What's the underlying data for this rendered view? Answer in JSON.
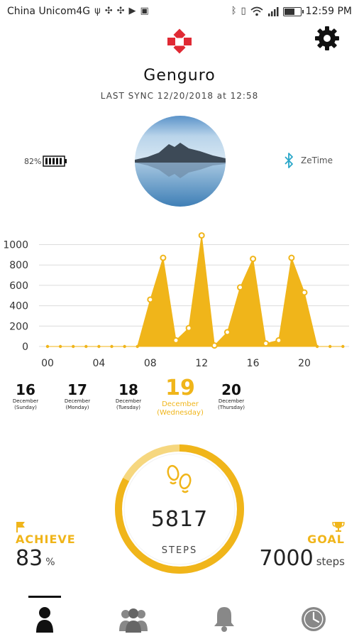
{
  "status_bar": {
    "carrier": "China Unicom4G",
    "time": "12:59 PM",
    "left_icons": [
      "usb-icon",
      "sync-icon",
      "app-icon",
      "play-icon",
      "image-icon"
    ],
    "right_icons": [
      "bluetooth-icon",
      "vibrate-icon",
      "wifi-icon",
      "signal-icon",
      "battery-icon"
    ]
  },
  "header": {
    "app_logo": "brand-logo",
    "settings_icon": "gear-icon"
  },
  "profile": {
    "username": "Genguro",
    "last_sync": "LAST SYNC 12/20/2018 at 12:58"
  },
  "device": {
    "battery_percent": "82%",
    "battery_level": 0.82,
    "device_name": "ZeTime",
    "bluetooth_icon": "bluetooth-icon"
  },
  "colors": {
    "accent": "#f0b51a",
    "accent_light": "#f6d77f",
    "bluetooth": "#2aa7c9",
    "logo_red": "#e02a34"
  },
  "chart_data": {
    "type": "area",
    "x": [
      0,
      1,
      2,
      3,
      4,
      5,
      6,
      7,
      8,
      9,
      10,
      11,
      12,
      13,
      14,
      15,
      16,
      17,
      18,
      19,
      20,
      21,
      22,
      23
    ],
    "y": [
      0,
      0,
      0,
      0,
      0,
      0,
      0,
      0,
      460,
      870,
      60,
      180,
      1090,
      10,
      140,
      580,
      860,
      30,
      60,
      870,
      530,
      0,
      0,
      0
    ],
    "xticks": [
      "00",
      "04",
      "08",
      "12",
      "16",
      "20"
    ],
    "xtick_positions": [
      0,
      4,
      8,
      12,
      16,
      20
    ],
    "yticks": [
      "0",
      "200",
      "400",
      "600",
      "800",
      "1000"
    ],
    "ytick_values": [
      0,
      200,
      400,
      600,
      800,
      1000
    ],
    "ylim": [
      0,
      1100
    ],
    "grid": true
  },
  "dates": [
    {
      "day": "16",
      "month": "December",
      "weekday": "(Sunday)"
    },
    {
      "day": "17",
      "month": "December",
      "weekday": "(Monday)"
    },
    {
      "day": "18",
      "month": "December",
      "weekday": "(Tuesday)"
    },
    {
      "day": "19",
      "month": "December",
      "weekday": "(Wednesday)"
    },
    {
      "day": "20",
      "month": "December",
      "weekday": "(Thursday)"
    }
  ],
  "selected_date_index": 3,
  "steps": {
    "value": "5817",
    "label": "STEPS",
    "progress": 0.83,
    "icon": "footsteps-icon"
  },
  "achieve": {
    "label": "ACHIEVE",
    "value": "83",
    "unit": "%",
    "icon": "flag-icon"
  },
  "goal": {
    "label": "GOAL",
    "value": "7000",
    "unit": "steps",
    "icon": "trophy-icon"
  },
  "bottom_nav": [
    {
      "icon": "person-icon",
      "active": true
    },
    {
      "icon": "group-icon",
      "active": false
    },
    {
      "icon": "bell-icon",
      "active": false
    },
    {
      "icon": "clock-icon",
      "active": false
    }
  ]
}
